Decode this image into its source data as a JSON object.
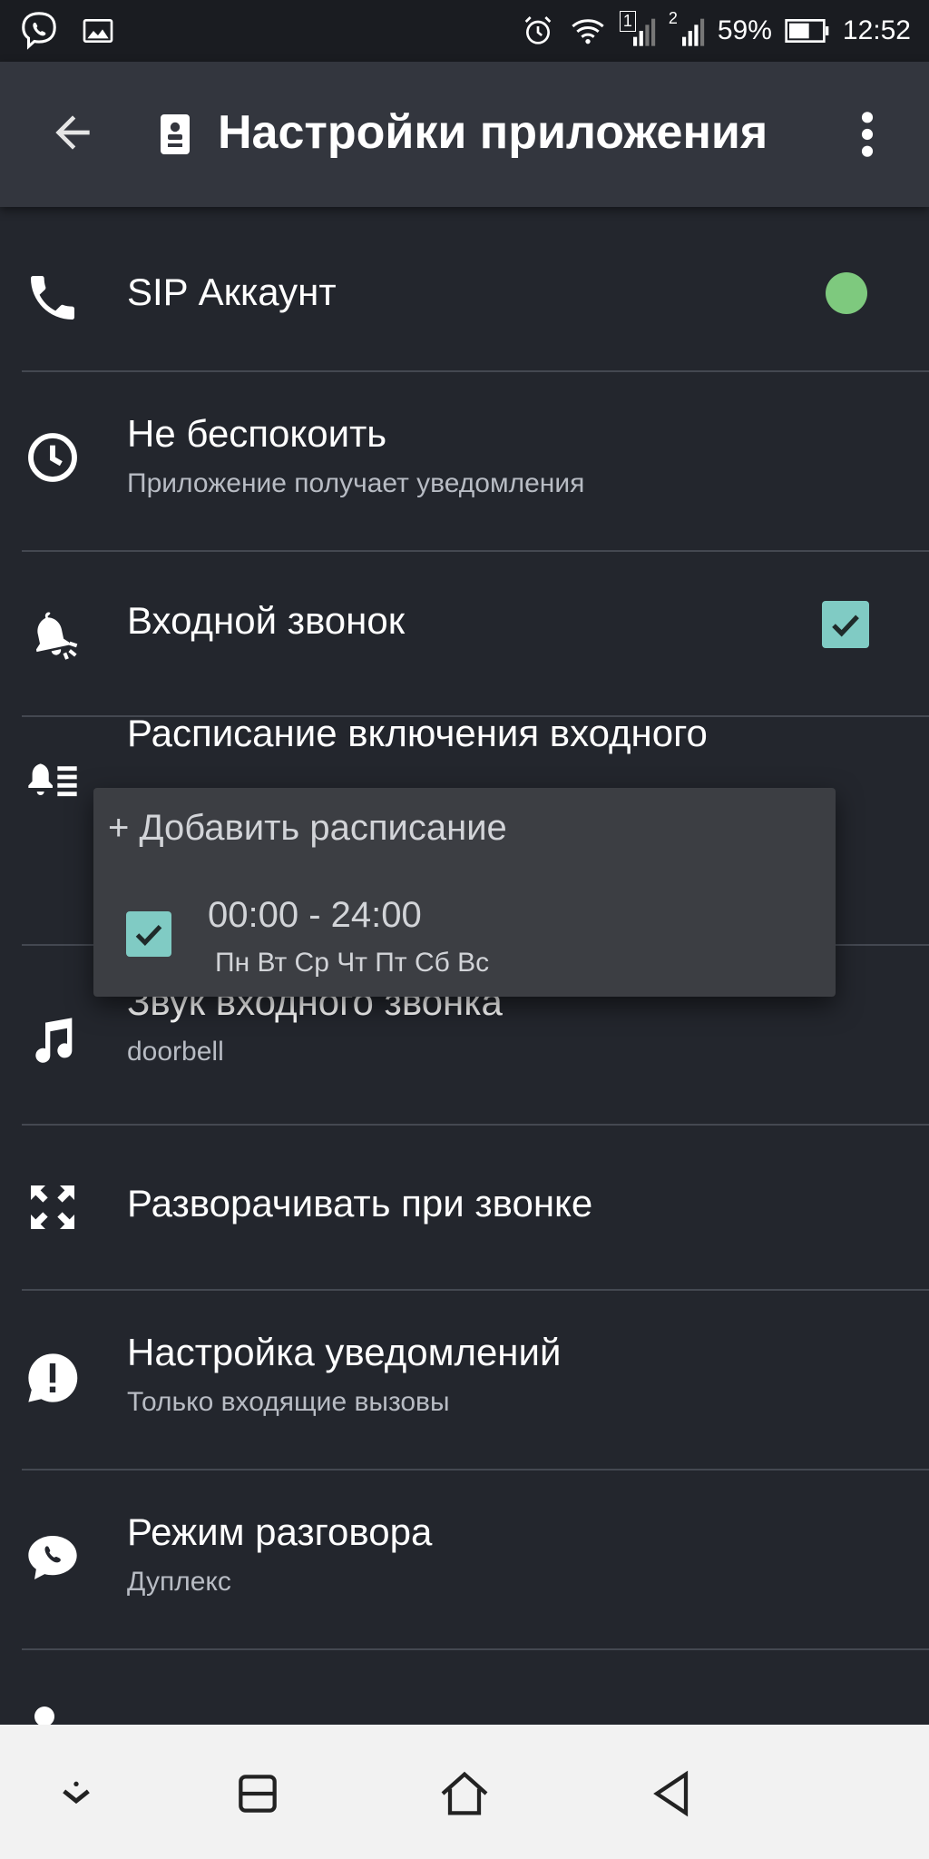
{
  "status_bar": {
    "battery": "59%",
    "time": "12:52",
    "sim1": "1",
    "sim2": "2",
    "icons": [
      "viber-icon",
      "gallery-icon",
      "alarm-icon",
      "wifi-icon",
      "signal-icon",
      "battery-icon"
    ]
  },
  "app_bar": {
    "title": "Настройки приложения",
    "icons": [
      "back-arrow-icon",
      "contact-card-icon",
      "more-vert-icon"
    ]
  },
  "settings": {
    "sip": {
      "label": "SIP Аккаунт",
      "status_color": "#7ec97e",
      "icon": "phone-icon"
    },
    "dnd": {
      "label": "Не беспокоить",
      "sub": "Приложение получает уведомления",
      "icon": "clock-icon"
    },
    "doorbell": {
      "label": "Входной звонок",
      "checked": true,
      "icon": "bell-ring-icon"
    },
    "schedule": {
      "label": "Расписание включения входного",
      "icon": "bell-list-icon"
    },
    "sound": {
      "label": "Звук входного звонка",
      "sub": "doorbell",
      "icon": "music-note-icon"
    },
    "expand": {
      "label": "Разворачивать при звонке",
      "icon": "expand-icon"
    },
    "notifications": {
      "label": "Настройка уведомлений",
      "sub": "Только входящие вызовы",
      "icon": "alert-bubble-icon"
    },
    "talk_mode": {
      "label": "Режим разговора",
      "sub": "Дуплекс",
      "icon": "chat-phone-icon"
    }
  },
  "popup": {
    "add_label": "+ Добавить расписание",
    "entries": [
      {
        "time": "00:00 - 24:00",
        "days": "Пн Вт Ср Чт Пт Сб Вс",
        "checked": true
      }
    ]
  },
  "nav_bar": {
    "icons": [
      "collapse-icon",
      "recents-icon",
      "home-icon",
      "back-icon"
    ]
  },
  "colors": {
    "background": "#23262d",
    "app_bar": "#33363e",
    "accent": "#80cbc4",
    "status_ok": "#7ec97e"
  }
}
